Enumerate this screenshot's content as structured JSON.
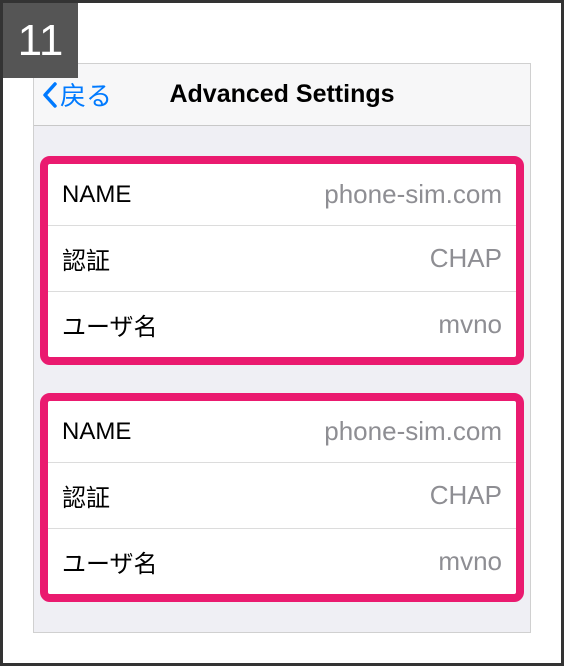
{
  "step_number": "11",
  "nav": {
    "back_label": "戻る",
    "title": "Advanced Settings"
  },
  "groups": [
    {
      "rows": [
        {
          "label": "NAME",
          "value": "phone-sim.com"
        },
        {
          "label": "認証",
          "value": "CHAP"
        },
        {
          "label": "ユーザ名",
          "value": "mvno"
        }
      ]
    },
    {
      "rows": [
        {
          "label": "NAME",
          "value": "phone-sim.com"
        },
        {
          "label": "認証",
          "value": "CHAP"
        },
        {
          "label": "ユーザ名",
          "value": "mvno"
        }
      ]
    }
  ]
}
